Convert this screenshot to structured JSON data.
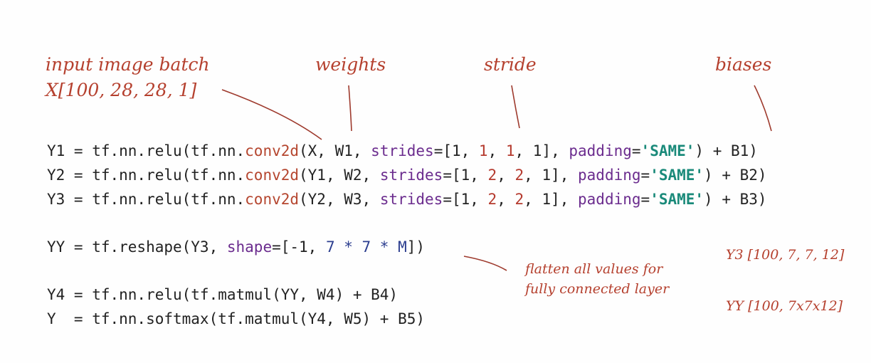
{
  "annotations": {
    "input_batch": "input image batch",
    "x_shape": "X[100, 28, 28, 1]",
    "weights": "weights",
    "stride": "stride",
    "biases": "biases",
    "flatten_line1": "flatten all values for",
    "flatten_line2": "fully connected layer",
    "y3_shape": "Y3 [100, 7, 7, 12]",
    "yy_shape": "YY [100, 7x7x12]"
  },
  "code": {
    "l1": {
      "a": "Y1 = tf.nn.relu(tf.nn.",
      "fn": "conv2d",
      "b": "(X, W1, ",
      "kw1": "strides",
      "c": "=[1, ",
      "n1": "1",
      "c2": ", ",
      "n2": "1",
      "d": ", 1], ",
      "kw2": "padding",
      "e": "=",
      "s": "'SAME'",
      "f": ") + B1)"
    },
    "l2": {
      "a": "Y2 = tf.nn.relu(tf.nn.",
      "fn": "conv2d",
      "b": "(Y1, W2, ",
      "kw1": "strides",
      "c": "=[1, ",
      "n1": "2",
      "c2": ", ",
      "n2": "2",
      "d": ", 1], ",
      "kw2": "padding",
      "e": "=",
      "s": "'SAME'",
      "f": ") + B2)"
    },
    "l3": {
      "a": "Y3 = tf.nn.relu(tf.nn.",
      "fn": "conv2d",
      "b": "(Y2, W3, ",
      "kw1": "strides",
      "c": "=[1, ",
      "n1": "2",
      "c2": ", ",
      "n2": "2",
      "d": ", 1], ",
      "kw2": "padding",
      "e": "=",
      "s": "'SAME'",
      "f": ") + B3)"
    },
    "l4": {
      "a": "YY = tf.reshape(Y3, ",
      "kw": "shape",
      "b": "=[-1, ",
      "n": "7 * 7 * M",
      "c": "])"
    },
    "l5": "Y4 = tf.nn.relu(tf.matmul(YY, W4) + B4)",
    "l6": "Y  = tf.nn.softmax(tf.matmul(Y4, W5) + B5)"
  }
}
